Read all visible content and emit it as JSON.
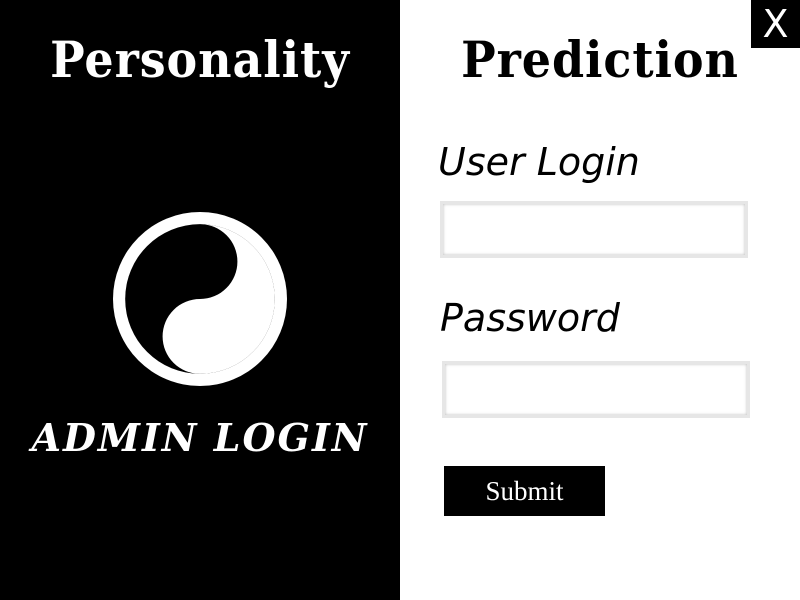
{
  "header": {
    "title_left": "Personality",
    "title_right": "Prediction"
  },
  "left_panel": {
    "logo_icon": "yin-yang-icon",
    "admin_label": "ADMIN LOGIN"
  },
  "form": {
    "user_label": "User Login",
    "user_value": "",
    "password_label": "Password",
    "password_value": "",
    "submit_label": "Submit"
  },
  "window": {
    "close_label": "X"
  },
  "colors": {
    "left_background": "#000000",
    "right_background": "#ffffff",
    "button_background": "#000000",
    "button_text": "#ffffff"
  }
}
